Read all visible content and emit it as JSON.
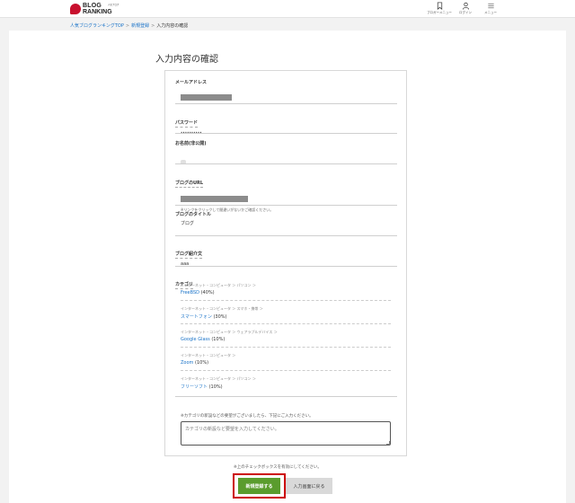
{
  "header": {
    "logo_line1": "BLOG",
    "logo_line2": "RANKING",
    "logo_small": "人気ブログ",
    "buttons": [
      {
        "label": "ブロガーメニュー",
        "icon": "bookmark-icon"
      },
      {
        "label": "ログイン",
        "icon": "user-icon"
      },
      {
        "label": "メニュー",
        "icon": "hamburger-icon"
      }
    ]
  },
  "breadcrumb": {
    "items": [
      "人気ブログランキングTOP",
      "新規登録",
      "入力内容の確認"
    ],
    "separator": ">"
  },
  "page": {
    "title": "入力内容の確認"
  },
  "fields": {
    "email_label": "メールアドレス",
    "password_label": "パスワード",
    "password_value": "••••••••••",
    "name_label": "お名前(非公開)",
    "url_label": "ブログのURL",
    "url_hint": "※リンクをクリックして間違いがないかご確認ください。",
    "title_label": "ブログのタイトル",
    "title_value": "ブログ",
    "intro_label": "ブログ紹介文",
    "intro_value": "aaa",
    "category_label": "カテゴリ"
  },
  "categories": [
    {
      "path": "インターネット・コンピュータ ＞ パソコン ＞",
      "name": "FreeBSD",
      "count": "(40%)"
    },
    {
      "path": "インターネット・コンピュータ ＞ スマホ・携帯 ＞",
      "name": "スマートフォン",
      "count": "(30%)"
    },
    {
      "path": "インターネット・コンピュータ ＞ ウェアラブルデバイス ＞",
      "name": "Google Glass",
      "count": "(10%)"
    },
    {
      "path": "インターネット・コンピュータ ＞",
      "name": "Zoom",
      "count": "(10%)"
    },
    {
      "path": "インターネット・コンピュータ ＞ パソコン ＞",
      "name": "フリーソフト",
      "count": "(10%)"
    }
  ],
  "request": {
    "label": "※カテゴリの新設などの要望がございましたら、下記にご入力ください。",
    "placeholder": "カテゴリの新設など要望を入力してください。"
  },
  "footer": {
    "check_note": "※上のチェックボックスを有効にしてください。",
    "submit_label": "新規登録する",
    "back_label": "入力画面に戻る"
  },
  "colors": {
    "accent_link": "#1a73c8",
    "submit_green": "#5a9c2d",
    "highlight_red": "#cc0000",
    "brand_red": "#c8102e"
  }
}
